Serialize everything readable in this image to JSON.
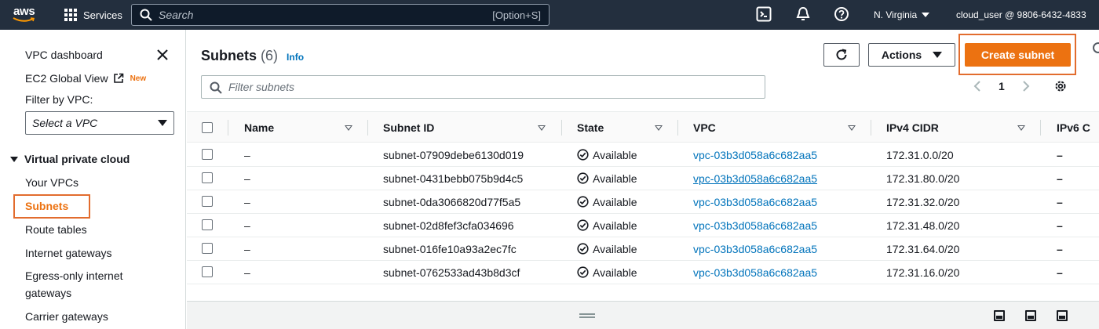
{
  "topnav": {
    "logo": "aws",
    "services_label": "Services",
    "search_placeholder": "Search",
    "search_shortcut": "[Option+S]",
    "region": "N. Virginia",
    "account": "cloud_user @ 9806-6432-4833",
    "icons": [
      "cloudshell-icon",
      "bell-icon",
      "help-icon"
    ]
  },
  "sidebar": {
    "vpc_dashboard": "VPC dashboard",
    "ec2_global_view": "EC2 Global View",
    "new_badge": "New",
    "filter_by_vpc_label": "Filter by VPC:",
    "select_vpc": "Select a VPC",
    "section_title": "Virtual private cloud",
    "items": [
      {
        "label": "Your VPCs"
      },
      {
        "label": "Subnets",
        "active": true
      },
      {
        "label": "Route tables"
      },
      {
        "label": "Internet gateways"
      },
      {
        "label": "Egress-only internet"
      },
      {
        "label": "gateways"
      },
      {
        "label": "Carrier gateways"
      }
    ]
  },
  "main": {
    "title": "Subnets",
    "count": "(6)",
    "info": "Info",
    "actions_label": "Actions",
    "create_label": "Create subnet",
    "filter_placeholder": "Filter subnets",
    "page_number": "1",
    "columns": [
      "Name",
      "Subnet ID",
      "State",
      "VPC",
      "IPv4 CIDR",
      "IPv6 C"
    ],
    "rows": [
      {
        "name": "–",
        "subnet_id": "subnet-07909debe6130d019",
        "state": "Available",
        "vpc": "vpc-03b3d058a6c682aa5",
        "cidr": "172.31.0.0/20",
        "ipv6": "–"
      },
      {
        "name": "–",
        "subnet_id": "subnet-0431bebb075b9d4c5",
        "state": "Available",
        "vpc": "vpc-03b3d058a6c682aa5",
        "cidr": "172.31.80.0/20",
        "ipv6": "–"
      },
      {
        "name": "–",
        "subnet_id": "subnet-0da3066820d77f5a5",
        "state": "Available",
        "vpc": "vpc-03b3d058a6c682aa5",
        "cidr": "172.31.32.0/20",
        "ipv6": "–"
      },
      {
        "name": "–",
        "subnet_id": "subnet-02d8fef3cfa034696",
        "state": "Available",
        "vpc": "vpc-03b3d058a6c682aa5",
        "cidr": "172.31.48.0/20",
        "ipv6": "–"
      },
      {
        "name": "–",
        "subnet_id": "subnet-016fe10a93a2ec7fc",
        "state": "Available",
        "vpc": "vpc-03b3d058a6c682aa5",
        "cidr": "172.31.64.0/20",
        "ipv6": "–"
      },
      {
        "name": "–",
        "subnet_id": "subnet-0762533ad43b8d3cf",
        "state": "Available",
        "vpc": "vpc-03b3d058a6c682aa5",
        "cidr": "172.31.16.0/20",
        "ipv6": "–"
      }
    ]
  },
  "colors": {
    "nav_bg": "#232f3e",
    "accent_orange": "#ec7211",
    "link_blue": "#0073bb",
    "highlight_outline": "#e26c2e"
  }
}
